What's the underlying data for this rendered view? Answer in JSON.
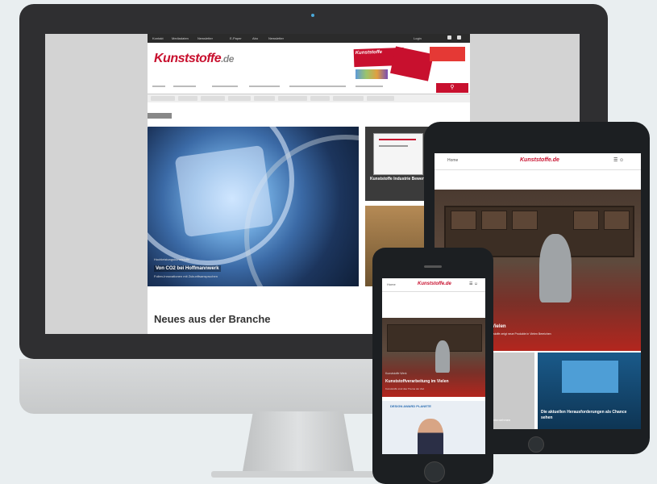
{
  "desktop": {
    "topbar": {
      "links": [
        "Kontakt",
        "Mediadaten",
        "Newsletter",
        "E-Paper",
        "Abo",
        "Newsletter"
      ],
      "login": "Login"
    },
    "logo": {
      "main": "Kunststoffe",
      "suffix": ".de"
    },
    "banner": {
      "title": "Kunststoffe"
    },
    "hero": {
      "kicker": "Hochleistungskunststoffe",
      "title": "Von CO2 bei Hoffmannwerk",
      "subtitle": "Folien-Innovationen mit Zukunftsanspruchen"
    },
    "side_card_1": {
      "title": "Kunststoffe Industrie Bewertung Planung"
    },
    "section_title": "Neues aus der Branche"
  },
  "tablet": {
    "menu_label": "Home",
    "logo": "Kunststoffe.de",
    "icons": "☰ ☺",
    "hero": {
      "caption": "in Vielen",
      "subtitle": "Kunststoffe zeigt neue Produkte in Vielen Bereichen"
    },
    "card2": {
      "title": "Die aktuellen Herausforderungen als Chance sehen"
    },
    "card1": {
      "title": "Unternehmen"
    }
  },
  "phone": {
    "menu_label": "Home",
    "logo": "Kunststoffe.de",
    "icons": "☰ ☺",
    "hero": {
      "kicker": "Kunststoffe Werk",
      "title": "Kunststoffverarbeitung im Vielen",
      "subtitle": "Kunststoffe sind das Thema der Zeit"
    },
    "card2": {
      "label": "DESIGN AWARD PLANETE"
    }
  }
}
